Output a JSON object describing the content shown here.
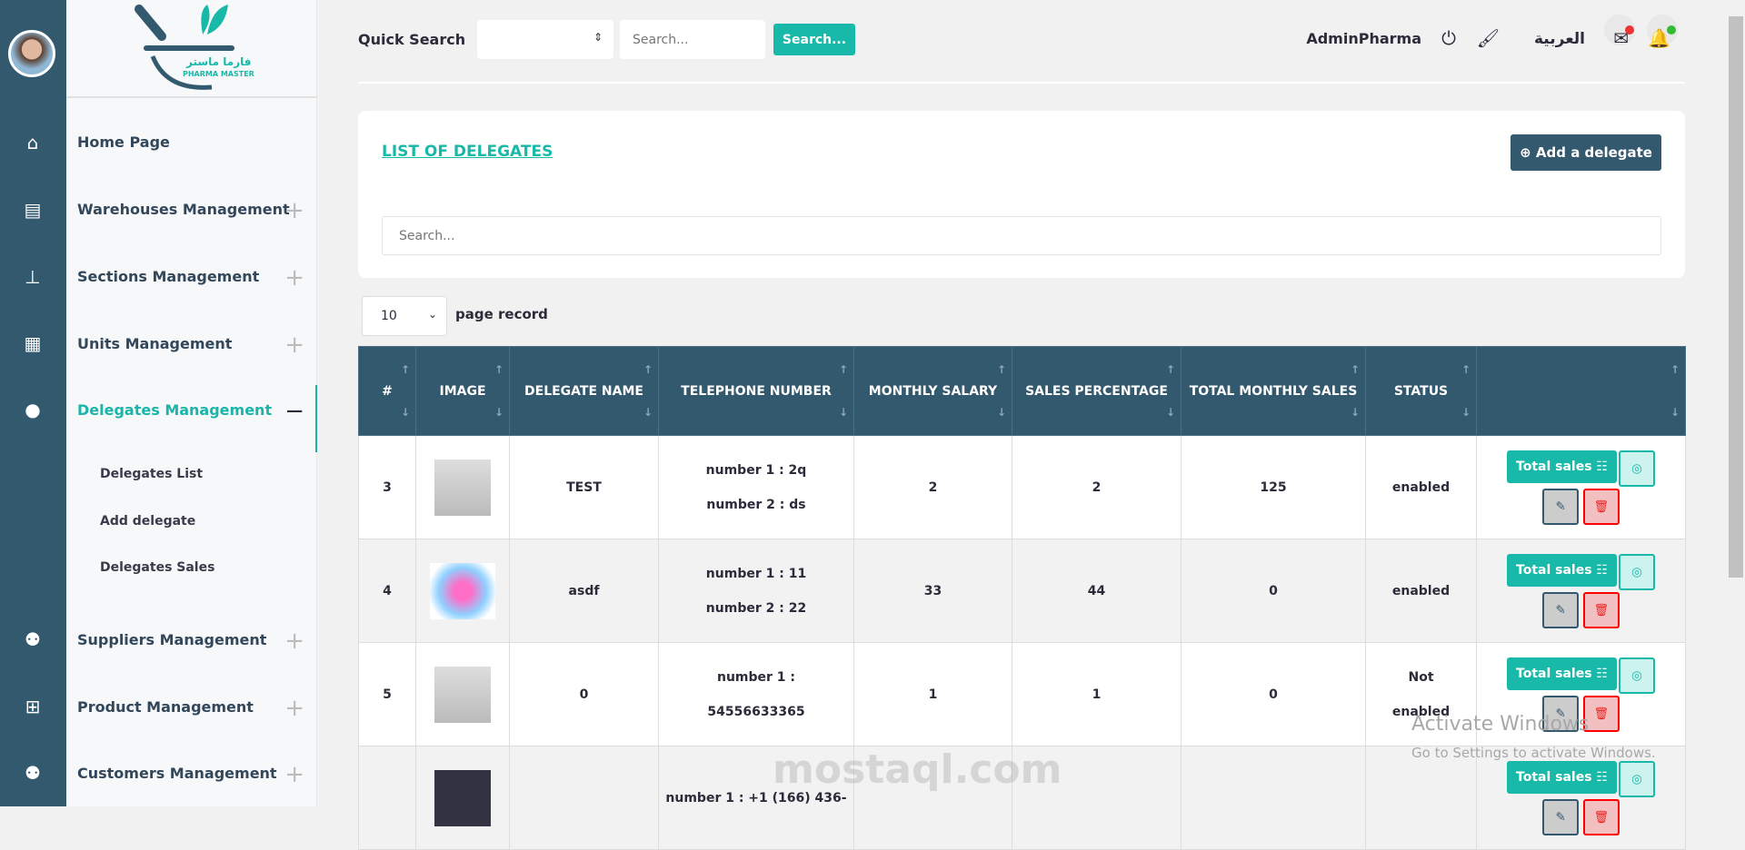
{
  "logo": {
    "arabic": "فارما ماستر",
    "latin": "PHARMA MASTER"
  },
  "sidebar": {
    "items": [
      {
        "label": "Home Page",
        "icon": "home-icon",
        "expand": ""
      },
      {
        "label": "Warehouses Management",
        "icon": "warehouse-icon",
        "expand": "+"
      },
      {
        "label": "Sections Management",
        "icon": "sitemap-icon",
        "expand": "+"
      },
      {
        "label": "Units Management",
        "icon": "grid-icon",
        "expand": "+"
      },
      {
        "label": "Delegates Management",
        "icon": "user-tie-icon",
        "expand": "−"
      },
      {
        "label": "Suppliers Management",
        "icon": "users-icon",
        "expand": "+"
      },
      {
        "label": "Product Management",
        "icon": "plus-square-icon",
        "expand": "+"
      },
      {
        "label": "Customers Management",
        "icon": "users-icon",
        "expand": "+"
      }
    ],
    "sub_items": [
      "Delegates List",
      "Add delegate",
      "Delegates Sales"
    ]
  },
  "topbar": {
    "quick_search": "Quick Search",
    "search_placeholder": "Search...",
    "search_button": "Search...",
    "user": "AdminPharma",
    "language": "العربية"
  },
  "card": {
    "title": "LIST OF DELEGATES",
    "add_button": "Add a delegate",
    "search_placeholder": "Search..."
  },
  "pagination": {
    "page_size": "10",
    "label": "page record"
  },
  "table": {
    "headers": [
      "#",
      "IMAGE",
      "DELEGATE NAME",
      "TELEPHONE NUMBER",
      "MONTHLY SALARY",
      "SALES PERCENTAGE",
      "TOTAL MONTHLY SALES",
      "STATUS",
      ""
    ],
    "rows": [
      {
        "id": "3",
        "name": "TEST",
        "phone1": "number 1 : 2q",
        "phone2": "number 2 : ds",
        "salary": "2",
        "percentage": "2",
        "total": "125",
        "status": "enabled"
      },
      {
        "id": "4",
        "name": "asdf",
        "phone1": "number 1 : 11",
        "phone2": "number 2 : 22",
        "salary": "33",
        "percentage": "44",
        "total": "0",
        "status": "enabled"
      },
      {
        "id": "5",
        "name": "0",
        "phone1": "number 1 :",
        "phone2": "54556633365",
        "salary": "1",
        "percentage": "1",
        "total": "0",
        "status": "Not enabled"
      },
      {
        "id": "",
        "name": "",
        "phone1": "number 1 : +1 (166) 436-",
        "phone2": "",
        "salary": "",
        "percentage": "",
        "total": "",
        "status": ""
      }
    ],
    "total_sales_label": "Total sales"
  },
  "watermark": {
    "title": "Activate Windows",
    "subtitle": "Go to Settings to activate Windows.",
    "site": "mostaql.com"
  },
  "colors": {
    "primary": "#33596f",
    "accent": "#19b9a9",
    "danger": "#ff0000"
  }
}
